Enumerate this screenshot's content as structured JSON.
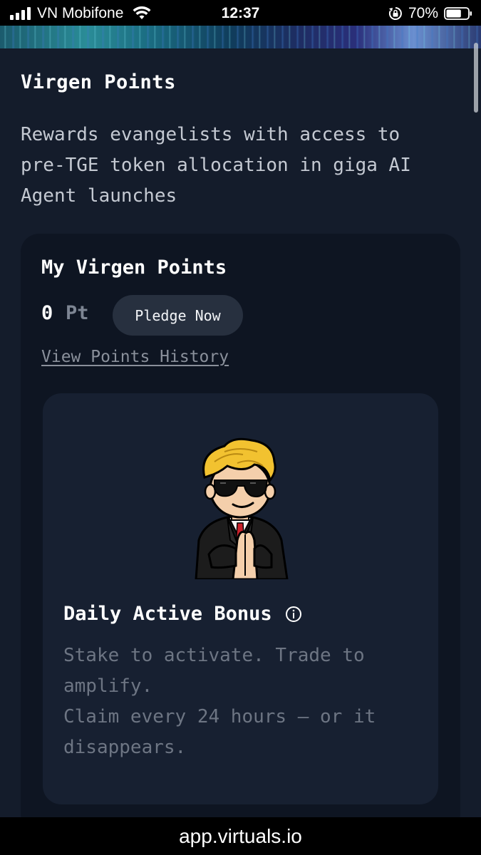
{
  "status_bar": {
    "carrier": "VN Mobifone",
    "time": "12:37",
    "battery_percent": "70%",
    "battery_level": 0.7
  },
  "main": {
    "title": "Virgen Points",
    "description": "Rewards evangelists with access to pre-TGE token allocation in giga AI Agent launches",
    "points_card": {
      "title": "My Virgen Points",
      "points_value": "0",
      "points_unit": "Pt",
      "pledge_label": "Pledge Now",
      "history_link": "View Points History",
      "daily_bonus": {
        "title": "Daily Active Bonus",
        "description_line1": "Stake to activate. Trade to amplify.",
        "description_line2": "Claim every 24 hours — or it disappears."
      }
    }
  },
  "browser": {
    "url": "app.virtuals.io"
  },
  "icons": [
    "signal-icon",
    "wifi-icon",
    "lock-rotation-icon",
    "battery-icon",
    "info-icon",
    "mascot-illustration"
  ]
}
